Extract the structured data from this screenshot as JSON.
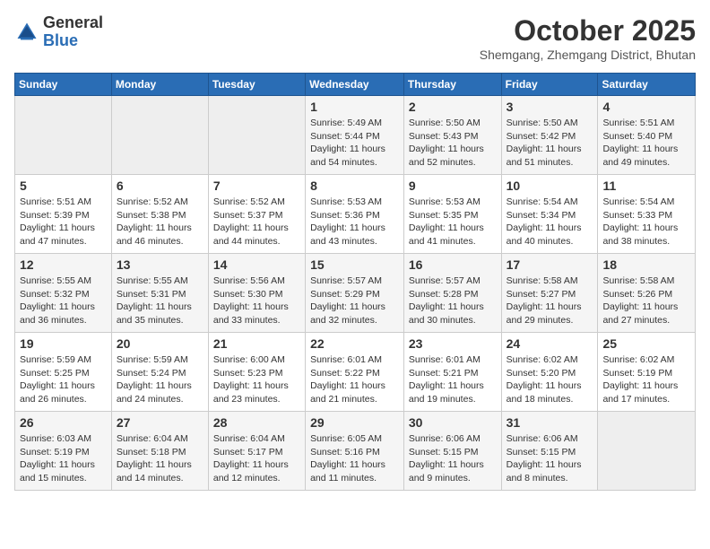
{
  "header": {
    "logo_general": "General",
    "logo_blue": "Blue",
    "month_title": "October 2025",
    "subtitle": "Shemgang, Zhemgang District, Bhutan"
  },
  "weekdays": [
    "Sunday",
    "Monday",
    "Tuesday",
    "Wednesday",
    "Thursday",
    "Friday",
    "Saturday"
  ],
  "weeks": [
    [
      {
        "day": "",
        "info": ""
      },
      {
        "day": "",
        "info": ""
      },
      {
        "day": "",
        "info": ""
      },
      {
        "day": "1",
        "info": "Sunrise: 5:49 AM\nSunset: 5:44 PM\nDaylight: 11 hours\nand 54 minutes."
      },
      {
        "day": "2",
        "info": "Sunrise: 5:50 AM\nSunset: 5:43 PM\nDaylight: 11 hours\nand 52 minutes."
      },
      {
        "day": "3",
        "info": "Sunrise: 5:50 AM\nSunset: 5:42 PM\nDaylight: 11 hours\nand 51 minutes."
      },
      {
        "day": "4",
        "info": "Sunrise: 5:51 AM\nSunset: 5:40 PM\nDaylight: 11 hours\nand 49 minutes."
      }
    ],
    [
      {
        "day": "5",
        "info": "Sunrise: 5:51 AM\nSunset: 5:39 PM\nDaylight: 11 hours\nand 47 minutes."
      },
      {
        "day": "6",
        "info": "Sunrise: 5:52 AM\nSunset: 5:38 PM\nDaylight: 11 hours\nand 46 minutes."
      },
      {
        "day": "7",
        "info": "Sunrise: 5:52 AM\nSunset: 5:37 PM\nDaylight: 11 hours\nand 44 minutes."
      },
      {
        "day": "8",
        "info": "Sunrise: 5:53 AM\nSunset: 5:36 PM\nDaylight: 11 hours\nand 43 minutes."
      },
      {
        "day": "9",
        "info": "Sunrise: 5:53 AM\nSunset: 5:35 PM\nDaylight: 11 hours\nand 41 minutes."
      },
      {
        "day": "10",
        "info": "Sunrise: 5:54 AM\nSunset: 5:34 PM\nDaylight: 11 hours\nand 40 minutes."
      },
      {
        "day": "11",
        "info": "Sunrise: 5:54 AM\nSunset: 5:33 PM\nDaylight: 11 hours\nand 38 minutes."
      }
    ],
    [
      {
        "day": "12",
        "info": "Sunrise: 5:55 AM\nSunset: 5:32 PM\nDaylight: 11 hours\nand 36 minutes."
      },
      {
        "day": "13",
        "info": "Sunrise: 5:55 AM\nSunset: 5:31 PM\nDaylight: 11 hours\nand 35 minutes."
      },
      {
        "day": "14",
        "info": "Sunrise: 5:56 AM\nSunset: 5:30 PM\nDaylight: 11 hours\nand 33 minutes."
      },
      {
        "day": "15",
        "info": "Sunrise: 5:57 AM\nSunset: 5:29 PM\nDaylight: 11 hours\nand 32 minutes."
      },
      {
        "day": "16",
        "info": "Sunrise: 5:57 AM\nSunset: 5:28 PM\nDaylight: 11 hours\nand 30 minutes."
      },
      {
        "day": "17",
        "info": "Sunrise: 5:58 AM\nSunset: 5:27 PM\nDaylight: 11 hours\nand 29 minutes."
      },
      {
        "day": "18",
        "info": "Sunrise: 5:58 AM\nSunset: 5:26 PM\nDaylight: 11 hours\nand 27 minutes."
      }
    ],
    [
      {
        "day": "19",
        "info": "Sunrise: 5:59 AM\nSunset: 5:25 PM\nDaylight: 11 hours\nand 26 minutes."
      },
      {
        "day": "20",
        "info": "Sunrise: 5:59 AM\nSunset: 5:24 PM\nDaylight: 11 hours\nand 24 minutes."
      },
      {
        "day": "21",
        "info": "Sunrise: 6:00 AM\nSunset: 5:23 PM\nDaylight: 11 hours\nand 23 minutes."
      },
      {
        "day": "22",
        "info": "Sunrise: 6:01 AM\nSunset: 5:22 PM\nDaylight: 11 hours\nand 21 minutes."
      },
      {
        "day": "23",
        "info": "Sunrise: 6:01 AM\nSunset: 5:21 PM\nDaylight: 11 hours\nand 19 minutes."
      },
      {
        "day": "24",
        "info": "Sunrise: 6:02 AM\nSunset: 5:20 PM\nDaylight: 11 hours\nand 18 minutes."
      },
      {
        "day": "25",
        "info": "Sunrise: 6:02 AM\nSunset: 5:19 PM\nDaylight: 11 hours\nand 17 minutes."
      }
    ],
    [
      {
        "day": "26",
        "info": "Sunrise: 6:03 AM\nSunset: 5:19 PM\nDaylight: 11 hours\nand 15 minutes."
      },
      {
        "day": "27",
        "info": "Sunrise: 6:04 AM\nSunset: 5:18 PM\nDaylight: 11 hours\nand 14 minutes."
      },
      {
        "day": "28",
        "info": "Sunrise: 6:04 AM\nSunset: 5:17 PM\nDaylight: 11 hours\nand 12 minutes."
      },
      {
        "day": "29",
        "info": "Sunrise: 6:05 AM\nSunset: 5:16 PM\nDaylight: 11 hours\nand 11 minutes."
      },
      {
        "day": "30",
        "info": "Sunrise: 6:06 AM\nSunset: 5:15 PM\nDaylight: 11 hours\nand 9 minutes."
      },
      {
        "day": "31",
        "info": "Sunrise: 6:06 AM\nSunset: 5:15 PM\nDaylight: 11 hours\nand 8 minutes."
      },
      {
        "day": "",
        "info": ""
      }
    ]
  ]
}
